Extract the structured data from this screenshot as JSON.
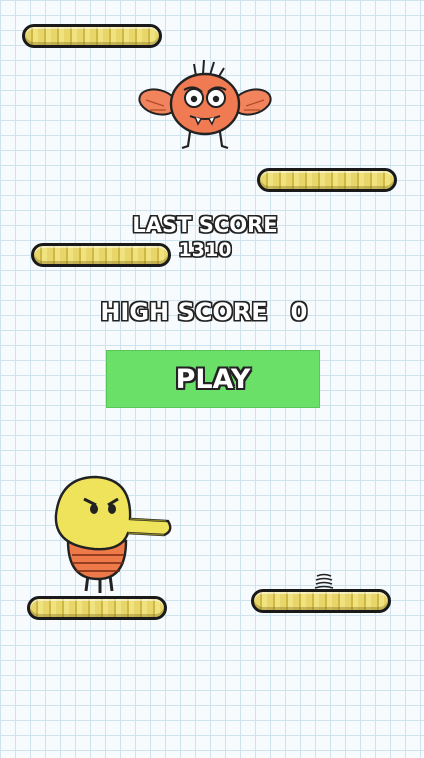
{
  "game": {
    "last_score_label": "LAST SCORE",
    "last_score_value": "1310",
    "high_score_label": "HIGH SCORE",
    "high_score_value": "0",
    "play_label": "PLAY"
  },
  "colors": {
    "play_button": "#6be069",
    "platform": "#e8d66a",
    "monster": "#f07a52",
    "doodler_body": "#f0e35c",
    "doodler_shorts": "#ef7a49",
    "grid_line": "#cfe3ee"
  },
  "sprites": [
    "monster-sprite",
    "doodler-sprite",
    "spring-sprite"
  ]
}
